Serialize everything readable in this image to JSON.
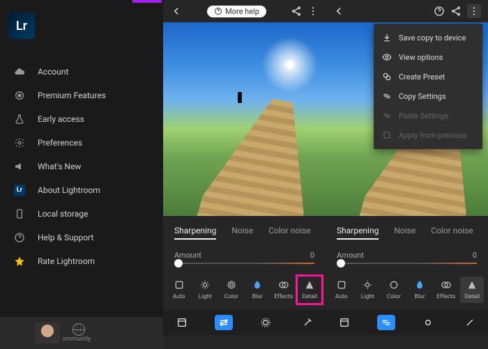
{
  "sidebar": {
    "logo_text": "Lr",
    "items": [
      {
        "label": "Account",
        "icon": "cloud"
      },
      {
        "label": "Premium Features",
        "icon": "badge"
      },
      {
        "label": "Early access",
        "icon": "flask"
      },
      {
        "label": "Preferences",
        "icon": "gear"
      },
      {
        "label": "What's New",
        "icon": "megaphone"
      },
      {
        "label": "About Lightroom",
        "icon": "lr"
      },
      {
        "label": "Local storage",
        "icon": "phone"
      },
      {
        "label": "Help & Support",
        "icon": "help"
      },
      {
        "label": "Rate Lightroom",
        "icon": "star"
      }
    ],
    "community_label": "ommunity"
  },
  "phone_a": {
    "help_label": "More help",
    "tabs": {
      "sharpening": "Sharpening",
      "noise": "Noise",
      "color_noise": "Color noise"
    },
    "slider": {
      "label": "Amount",
      "value": "0"
    },
    "tools": {
      "auto": "Auto",
      "light": "Light",
      "color": "Color",
      "blur": "Blur",
      "effects": "Effects",
      "detail": "Detail"
    }
  },
  "phone_b": {
    "tabs": {
      "sharpening": "Sharpening",
      "noise": "Noise",
      "color_noise": "Color noise"
    },
    "slider": {
      "label": "Amount",
      "value": "0"
    },
    "tools": {
      "auto": "Auto",
      "light": "Light",
      "color": "Color",
      "blur": "Blur",
      "effects": "Effects",
      "detail": "Detail"
    },
    "menu": {
      "save": "Save copy to device",
      "view": "View options",
      "preset": "Create Preset",
      "copy": "Copy Settings",
      "paste": "Paste Settings",
      "apply": "Apply from previous"
    }
  }
}
